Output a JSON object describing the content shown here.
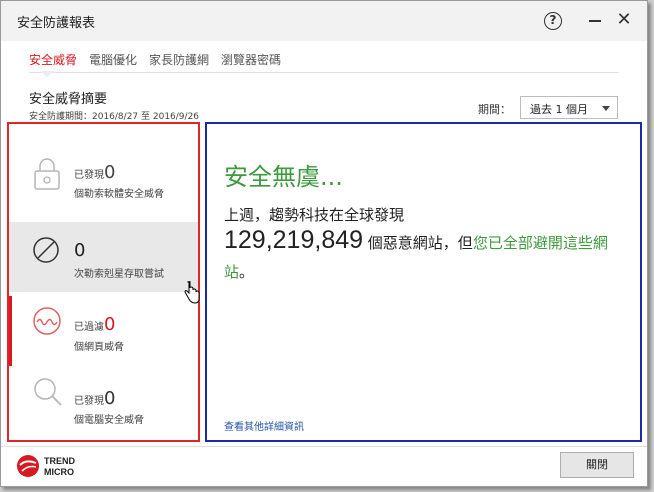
{
  "window": {
    "title": "安全防護報表",
    "help_glyph": "?",
    "close_glyph": "✕"
  },
  "tabs": [
    {
      "label": "安全威脅",
      "active": true
    },
    {
      "label": "電腦優化",
      "active": false
    },
    {
      "label": "家長防護網",
      "active": false
    },
    {
      "label": "瀏覽器密碼",
      "active": false
    }
  ],
  "summary": {
    "title": "安全威脅摘要",
    "period": "安全防護期間：2016/8/27 至 2016/9/26"
  },
  "period_filter": {
    "label": "期間：",
    "value": "過去 1 個月"
  },
  "threats": [
    {
      "prefix": "已發現",
      "count": "0",
      "desc": "個勒索軟體安全威脅",
      "icon": "lock-icon"
    },
    {
      "prefix": "",
      "count": "0",
      "desc": "次勒索剋星存取嘗試",
      "icon": "blocked-icon"
    },
    {
      "prefix": "已過濾",
      "count": "0",
      "desc": "個網頁威脅",
      "icon": "web-threat-icon"
    },
    {
      "prefix": "已發現",
      "count": "0",
      "desc": "個電腦安全威脅",
      "icon": "magnifier-icon"
    }
  ],
  "detail": {
    "headline": "安全無虞...",
    "line1": "上週，趨勢科技在全球發現",
    "big_number": "129,219,849",
    "line2_mid": " 個惡意網站，但",
    "line2_green": "您已全部避開這些網站",
    "line2_end": "。",
    "more_link": "查看其他詳細資訊"
  },
  "footer": {
    "logo_word1": "TREND",
    "logo_word2": "MICRO",
    "close_label": "關閉"
  },
  "colors": {
    "accent_red": "#d71920",
    "safe_green": "#3d9a3d",
    "link_blue": "#1f56a8"
  }
}
